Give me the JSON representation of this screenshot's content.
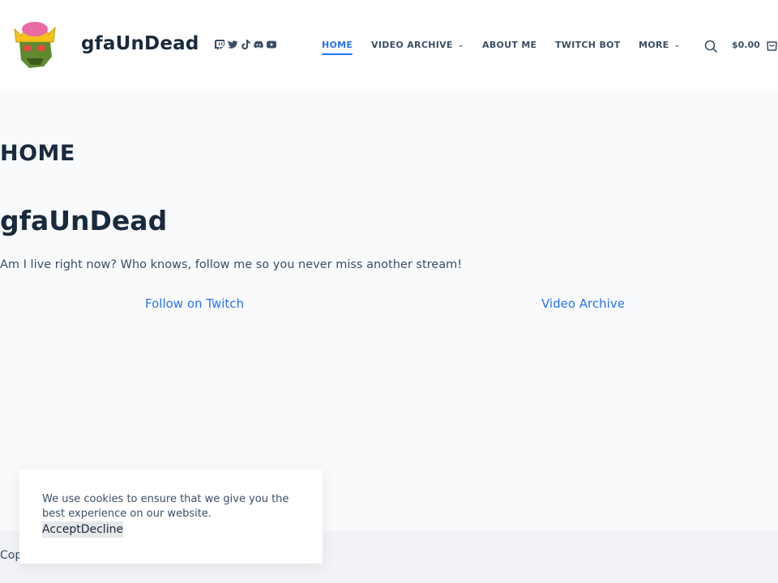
{
  "site": {
    "title": "gfaUnDead",
    "logo_icon": "zombie-king-avatar-icon"
  },
  "socials": [
    "twitch-icon",
    "twitter-icon",
    "tiktok-icon",
    "discord-icon",
    "youtube-icon"
  ],
  "nav": {
    "home": "HOME",
    "video_archive": "VIDEO ARCHIVE",
    "about_me": "ABOUT ME",
    "twitch_bot": "TWITCH BOT",
    "more": "MORE",
    "cart_amount": "$0.00"
  },
  "main": {
    "page_title": "HOME",
    "hero_title": "gfaUnDead",
    "hero_text": "Am I live right now? Who knows, follow me so you never miss another stream!",
    "link_twitch": "Follow on Twitch",
    "link_archive": "Video Archive"
  },
  "footer": {
    "text": "Cop"
  },
  "cookie": {
    "text": "We use cookies to ensure that we give you the best experience on our website.",
    "accept": "Accept",
    "decline": "Decline"
  },
  "colors": {
    "accent": "#2872fa",
    "heading": "#192a3d",
    "body": "#3a4f66",
    "bg": "#f8fafc"
  }
}
